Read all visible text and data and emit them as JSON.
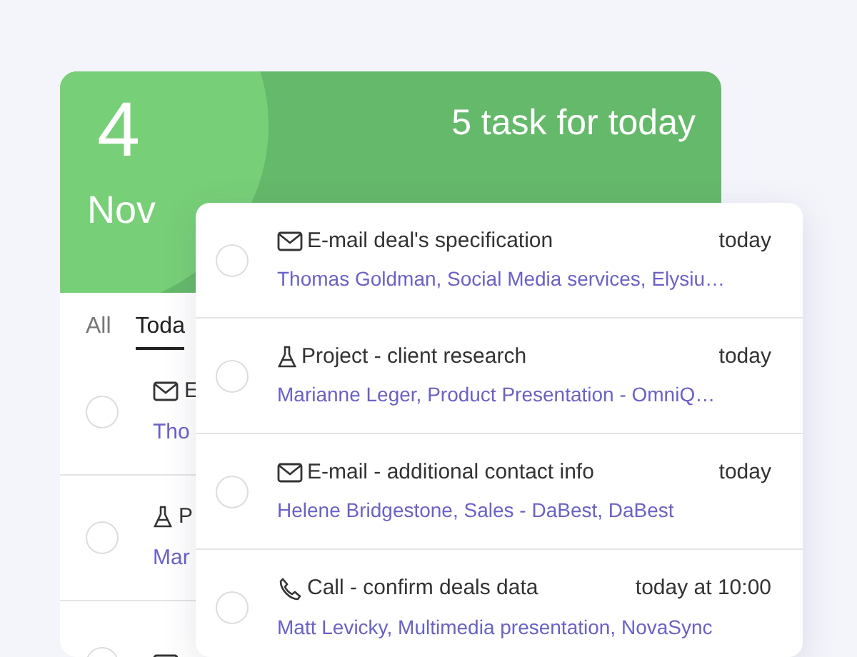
{
  "header": {
    "day": "4",
    "month": "Nov",
    "summary": "5 task for today"
  },
  "tabs": [
    {
      "label": "All",
      "selected": false
    },
    {
      "label": "Toda",
      "selected": true
    }
  ],
  "back_tasks": [
    {
      "kind": "email",
      "title": "E",
      "contacts": "Tho",
      "checked": false
    },
    {
      "kind": "project",
      "title": "P",
      "contacts": "Mar",
      "checked": false
    },
    {
      "kind": "email",
      "checked": false
    }
  ],
  "tasks": [
    {
      "kind": "email",
      "title": "E-mail deal's specification",
      "due": "today",
      "contacts": "Thomas Goldman, Social Media services, Elysiu…",
      "checked": false
    },
    {
      "kind": "project",
      "title": "Project - client research",
      "due": "today",
      "contacts": "Marianne Leger, Product Presentation - OmniQ…",
      "checked": false
    },
    {
      "kind": "email",
      "title": "E-mail - additional contact info",
      "due": "today",
      "contacts": "Helene Bridgestone, Sales - DaBest, DaBest",
      "checked": false
    },
    {
      "kind": "call",
      "title": "Call - confirm deals data",
      "due": "today at 10:00",
      "contacts": "Matt Levicky, Multimedia presentation, NovaSync",
      "checked": false
    }
  ]
}
